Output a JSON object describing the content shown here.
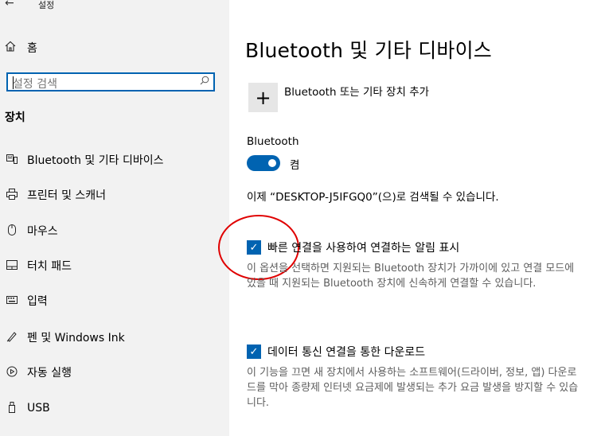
{
  "window": {
    "back_glyph": "←",
    "title": "설정"
  },
  "sidebar": {
    "home_label": "홈",
    "search_placeholder": "설정 검색",
    "section_title": "장치",
    "items": [
      {
        "label": "Bluetooth 및 기타 디바이스",
        "icon": "bluetooth-devices-icon"
      },
      {
        "label": "프린터 및 스캐너",
        "icon": "printer-icon"
      },
      {
        "label": "마우스",
        "icon": "mouse-icon"
      },
      {
        "label": "터치 패드",
        "icon": "touchpad-icon"
      },
      {
        "label": "입력",
        "icon": "keyboard-icon"
      },
      {
        "label": "펜 및 Windows Ink",
        "icon": "pen-icon"
      },
      {
        "label": "자동 실행",
        "icon": "autoplay-icon"
      },
      {
        "label": "USB",
        "icon": "usb-icon"
      }
    ]
  },
  "main": {
    "title": "Bluetooth 및 기타 디바이스",
    "add_device_label": "Bluetooth 또는 기타 장치 추가",
    "bluetooth_label": "Bluetooth",
    "bluetooth_state": "켬",
    "discoverable_text": "이제 “DESKTOP-J5IFGQ0”(으)로 검색될 수 있습니다.",
    "swift_pair_label": "빠른 연결을 사용하여 연결하는 알림 표시",
    "swift_pair_desc": "이 옵션을 선택하면 지원되는 Bluetooth 장치가 가까이에 있고 연결 모드에 있을 때 지원되는 Bluetooth 장치에 신속하게 연결할 수 있습니다.",
    "metered_label": "데이터 통신 연결을 통한 다운로드",
    "metered_desc": "이 기능을 끄면 새 장치에서 사용하는 소프트웨어(드라이버, 정보, 앱) 다운로드를 막아 종량제 인터넷 요금제에 발생되는 추가 요금 발생을 방지할 수 있습니다.",
    "checked_glyph": "✓",
    "add_glyph": "+"
  },
  "colors": {
    "accent": "#0063b1",
    "highlight_circle": "#e00000",
    "sidebar_bg": "#f2f2f2"
  }
}
